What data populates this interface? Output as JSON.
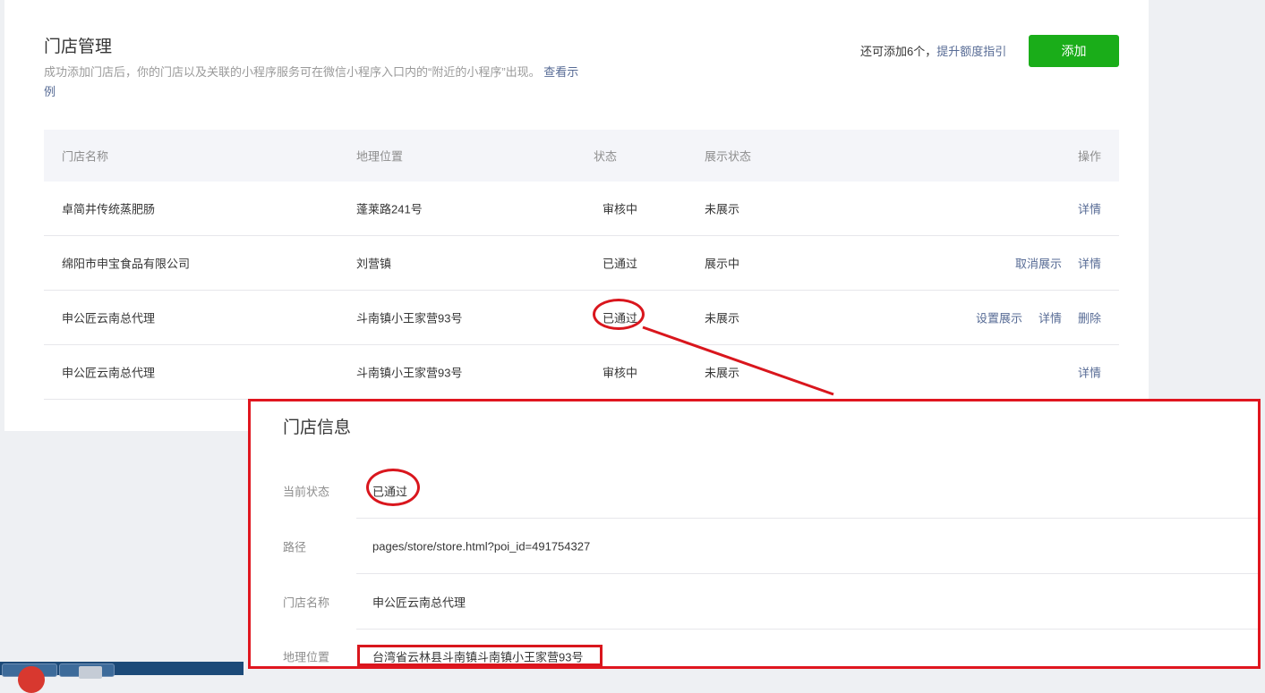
{
  "header": {
    "title": "门店管理",
    "desc_text": "成功添加门店后，你的门店以及关联的小程序服务可在微信小程序入口内的“附近的小程序”出现。",
    "desc_link": "查看示例",
    "quota_text": "还可添加6个，",
    "quota_link": "提升额度指引",
    "add_button": "添加"
  },
  "table": {
    "columns": [
      "门店名称",
      "地理位置",
      "状态",
      "展示状态",
      "操作"
    ],
    "rows": [
      {
        "name": "卓简井传统蒸肥肠",
        "location": "蓬莱路241号",
        "status": "审核中",
        "display": "未展示",
        "ops": [
          "详情"
        ]
      },
      {
        "name": "绵阳市申宝食品有限公司",
        "location": "刘营镇",
        "status": "已通过",
        "display": "展示中",
        "ops": [
          "取消展示",
          "详情"
        ]
      },
      {
        "name": "申公匠云南总代理",
        "location": "斗南镇小王家营93号",
        "status": "已通过",
        "display": "未展示",
        "ops": [
          "设置展示",
          "详情",
          "删除"
        ]
      },
      {
        "name": "申公匠云南总代理",
        "location": "斗南镇小王家营93号",
        "status": "审核中",
        "display": "未展示",
        "ops": [
          "详情"
        ]
      }
    ]
  },
  "popup": {
    "title": "门店信息",
    "fields": [
      {
        "label": "当前状态",
        "value": "已通过"
      },
      {
        "label": "路径",
        "value": "pages/store/store.html?poi_id=491754327"
      },
      {
        "label": "门店名称",
        "value": "申公匠云南总代理"
      },
      {
        "label": "地理位置",
        "value": "台湾省云林县斗南镇斗南镇小王家营93号"
      }
    ]
  },
  "colors": {
    "primary_green": "#1aad19",
    "link_blue": "#576b95",
    "annotation_red": "#d9161d"
  }
}
